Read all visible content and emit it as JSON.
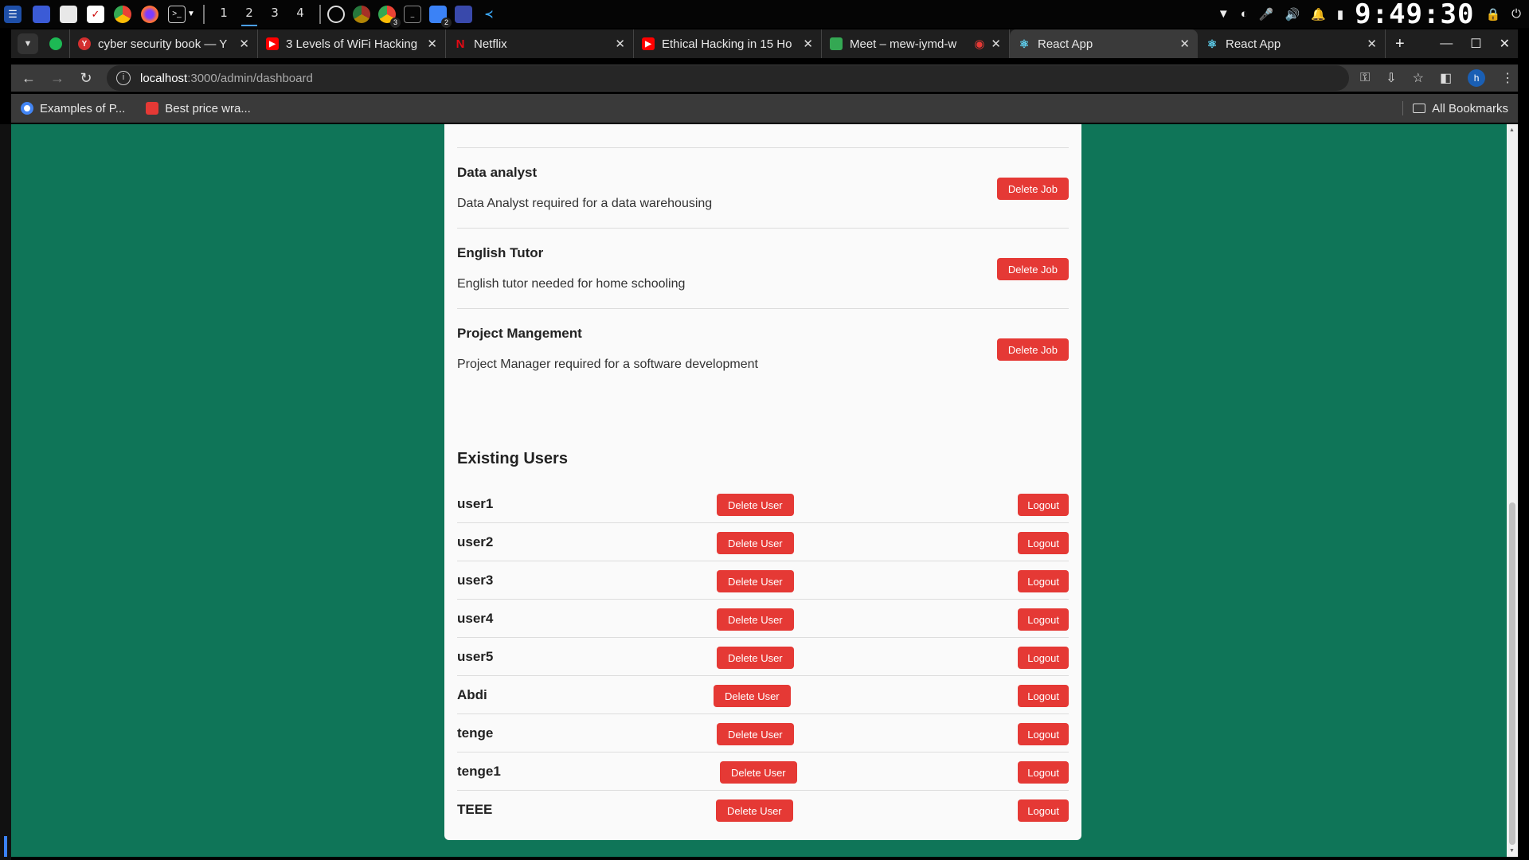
{
  "taskbar": {
    "workspaces": [
      "1",
      "2",
      "3",
      "4"
    ],
    "active_workspace": "2",
    "badges": {
      "chrome_count": "3",
      "msg_count": "2"
    },
    "clock": "9:49:30"
  },
  "tabs": [
    {
      "title": "cyber security book — Y",
      "favicon": "yandex-icon",
      "color": "#d32f2f"
    },
    {
      "title": "3 Levels of WiFi Hacking",
      "favicon": "youtube-icon",
      "color": "#ff0000"
    },
    {
      "title": "Netflix",
      "favicon": "netflix-icon",
      "color": "#e50914"
    },
    {
      "title": "Ethical Hacking in 15 Ho",
      "favicon": "youtube-icon",
      "color": "#ff0000"
    },
    {
      "title": "Meet – mew-iymd-w",
      "favicon": "meet-icon",
      "color": "#34a853"
    },
    {
      "title": "React App",
      "favicon": "react-icon",
      "color": "#61dafb",
      "active": true
    },
    {
      "title": "React App",
      "favicon": "react-icon",
      "color": "#61dafb"
    }
  ],
  "address": {
    "host": "localhost",
    "path": ":3000/admin/dashboard"
  },
  "profile_initial": "h",
  "bookmarks": [
    {
      "label": "Examples of P...",
      "color": "#4285f4"
    },
    {
      "label": "Best price wra...",
      "color": "#e53935"
    }
  ],
  "all_bookmarks_label": "All Bookmarks",
  "jobs": [
    {
      "title": "Data analyst",
      "description": "Data Analyst required for a data warehousing",
      "button": "Delete Job"
    },
    {
      "title": "English Tutor",
      "description": "English tutor needed for home schooling",
      "button": "Delete Job"
    },
    {
      "title": "Project Mangement",
      "description": "Project Manager required for a software development",
      "button": "Delete Job"
    }
  ],
  "users_section": {
    "title": "Existing Users",
    "delete_label": "Delete User",
    "logout_label": "Logout",
    "users": [
      "user1",
      "user2",
      "user3",
      "user4",
      "user5",
      "Abdi",
      "tenge",
      "tenge1",
      "TEEE"
    ]
  },
  "colors": {
    "page_bg": "#0f7558",
    "danger": "#e53935",
    "card_bg": "#fafafa"
  }
}
